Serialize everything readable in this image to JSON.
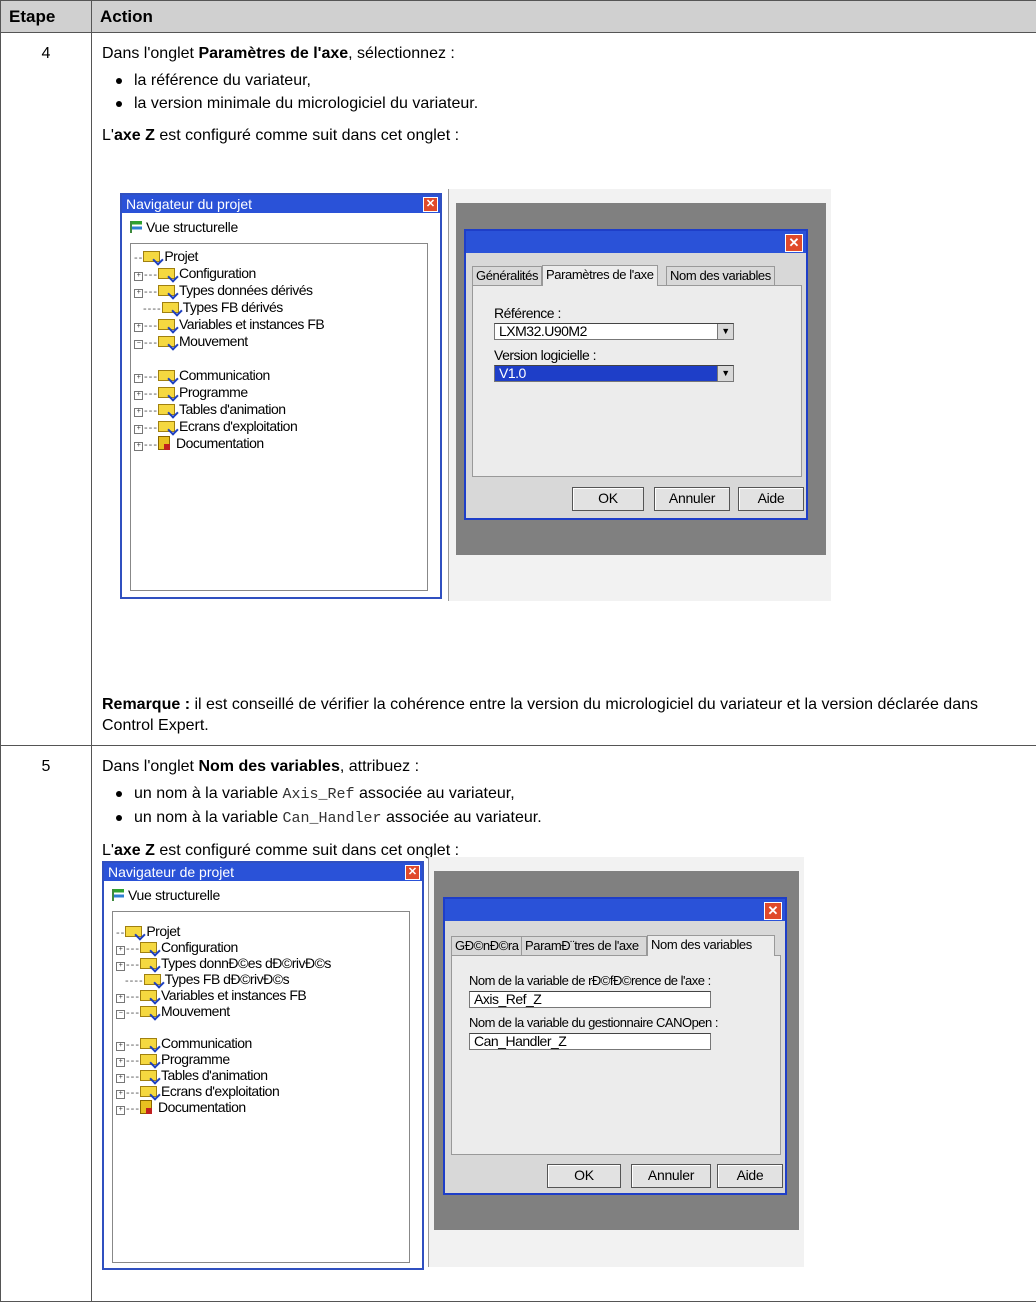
{
  "table": {
    "header": {
      "step": "Etape",
      "action": "Action"
    }
  },
  "step4": {
    "number": "4",
    "intro_pre": "Dans l'onglet ",
    "intro_bold": "Paramètres de l'axe",
    "intro_post": ", sélectionnez :",
    "bullets": [
      "la référence du variateur,",
      "la version minimale du micrologiciel du variateur."
    ],
    "config_pre": "L'",
    "config_bold": "axe Z",
    "config_post": " est configuré comme suit dans cet onglet :",
    "note_bold": "Remarque :",
    "note_text": " il est conseillé de vérifier la cohérence entre la version du micrologiciel du variateur et la version déclarée dans Control Expert.",
    "navigator": {
      "title": "Navigateur du projet",
      "view": "Vue structurelle",
      "items": [
        "Projet",
        "Configuration",
        "Types données dérivés",
        "Types FB dérivés",
        "Variables et instances FB",
        "Mouvement",
        "Communication",
        "Programme",
        "Tables d'animation",
        "Ecrans d'exploitation",
        "Documentation"
      ]
    },
    "dialog": {
      "tabs": [
        "Généralités",
        "Paramètres de l'axe",
        "Nom des variables"
      ],
      "ref_label": "Référence :",
      "ref_value": "LXM32.U90M2",
      "version_label": "Version logicielle :",
      "version_value": "V1.0",
      "buttons": [
        "OK",
        "Annuler",
        "Aide"
      ]
    }
  },
  "step5": {
    "number": "5",
    "intro_pre": "Dans l'onglet ",
    "intro_bold": "Nom des variables",
    "intro_post": ", attribuez :",
    "bullet1_pre": "un nom à la variable ",
    "bullet1_code": "Axis_Ref",
    "bullet1_post": " associée au variateur,",
    "bullet2_pre": "un nom à la variable ",
    "bullet2_code": "Can_Handler",
    "bullet2_post": " associée au variateur.",
    "config_pre": "L'",
    "config_bold": "axe Z",
    "config_post": " est configuré comme suit dans cet onglet :",
    "navigator": {
      "title": "Navigateur de projet",
      "view": "Vue structurelle",
      "items": [
        "Projet",
        "Configuration",
        "Types donnÐ©es dÐ©rivÐ©s",
        "Types FB dÐ©rivÐ©s",
        "Variables et instances FB",
        "Mouvement",
        "Communication",
        "Programme",
        "Tables d'animation",
        "Ecrans d'exploitation",
        "Documentation"
      ]
    },
    "dialog": {
      "tabs": [
        "GÐ©nÐ©ra",
        "ParamÐ¨tres de l'axe",
        "Nom des variables"
      ],
      "axis_label": "Nom de la variable de rÐ©fÐ©rence de l'axe :",
      "axis_value": "Axis_Ref_Z",
      "can_label": "Nom de la variable du gestionnaire CANOpen :",
      "can_value": "Can_Handler_Z",
      "buttons": [
        "OK",
        "Annuler",
        "Aide"
      ]
    }
  }
}
